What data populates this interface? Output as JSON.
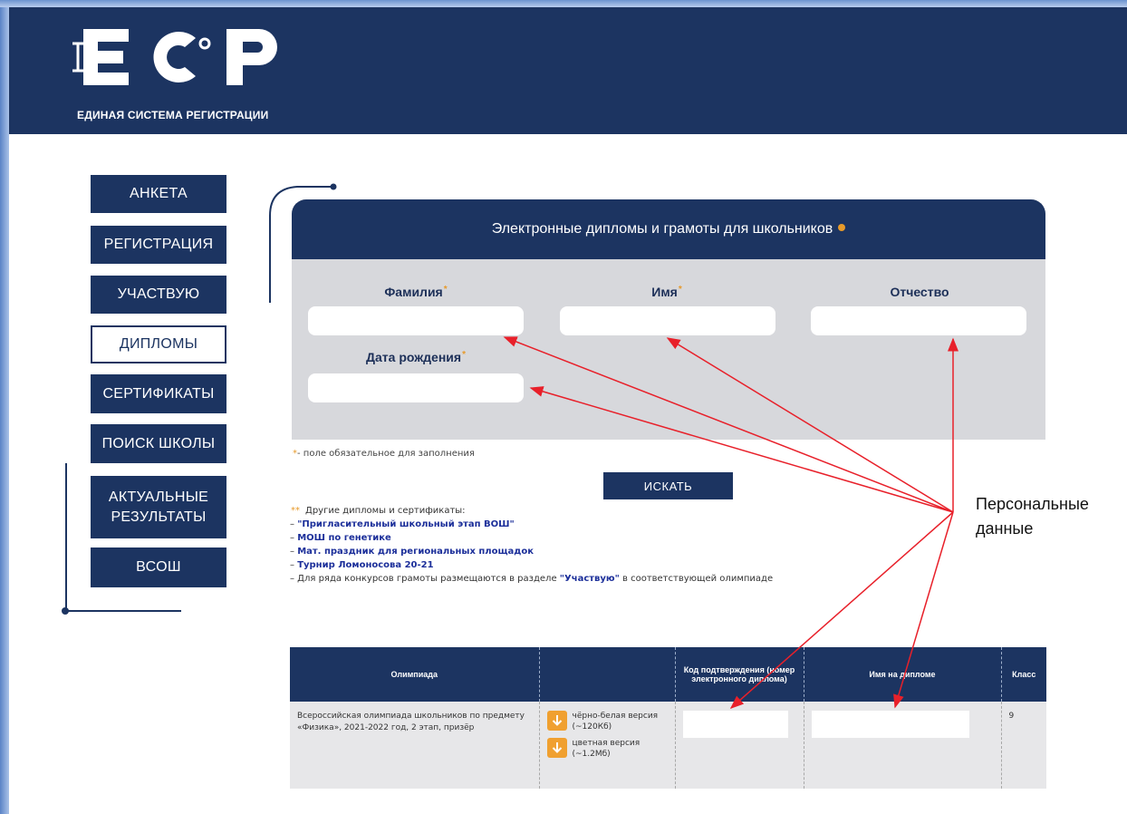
{
  "header": {
    "logo_letters": "ЕСР",
    "subtitle": "ЕДИНАЯ СИСТЕМА РЕГИСТРАЦИИ"
  },
  "nav": {
    "items": [
      {
        "label": "АНКЕТА",
        "active": false
      },
      {
        "label": "РЕГИСТРАЦИЯ",
        "active": false
      },
      {
        "label": "УЧАСТВУЮ",
        "active": false
      },
      {
        "label": "ДИПЛОМЫ",
        "active": true
      },
      {
        "label": "СЕРТИФИКАТЫ",
        "active": false
      },
      {
        "label": "ПОИСК ШКОЛЫ",
        "active": false
      },
      {
        "label": "АКТУАЛЬНЫЕ РЕЗУЛЬТАТЫ",
        "active": false
      },
      {
        "label": "ВСОШ",
        "active": false
      }
    ]
  },
  "search_card": {
    "title": "Электронные дипломы и грамоты для школьников",
    "fields": {
      "surname": {
        "label": "Фамилия",
        "value": ""
      },
      "name": {
        "label": "Имя",
        "value": ""
      },
      "patronymic": {
        "label": "Отчество",
        "value": ""
      },
      "birthdate": {
        "label": "Дата рождения",
        "value": ""
      }
    },
    "required_mark": "*"
  },
  "required_note": "- поле обязательное для заполнения",
  "search_button": "ИСКАТЬ",
  "other": {
    "intro": "Другие дипломы и сертификаты:",
    "links": [
      "\"Пригласительный школьный этап ВОШ\"",
      "МОШ по генетике",
      "Мат. праздник для региональных площадок",
      "Турнир Ломоносова 20-21"
    ],
    "note_prefix": "– Для ряда конкурсов грамоты размещаются в разделе ",
    "note_link": "\"Участвую\"",
    "note_suffix": " в соответствующей олимпиаде"
  },
  "results_table": {
    "headers": [
      "Олимпиада",
      "",
      "Код подтверждения (номер электронного диплома)",
      "Имя на дипломе",
      "Класс"
    ],
    "rows": [
      {
        "olympiad": "Всероссийская олимпиада школьников по предмету «Физика», 2021-2022 год, 2 этап, призёр",
        "downloads": [
          "чёрно-белая версия (~120Кб)",
          "цветная версия (~1.2Мб)"
        ],
        "code": "",
        "diploma_name": "",
        "grade": "9"
      }
    ]
  },
  "annotation": {
    "text_line1": "Персональные",
    "text_line2": "данные",
    "color": "#e8202a"
  },
  "colors": {
    "navy": "#1c3461",
    "accent": "#e79a2a",
    "panel": "#d7d8dc"
  }
}
